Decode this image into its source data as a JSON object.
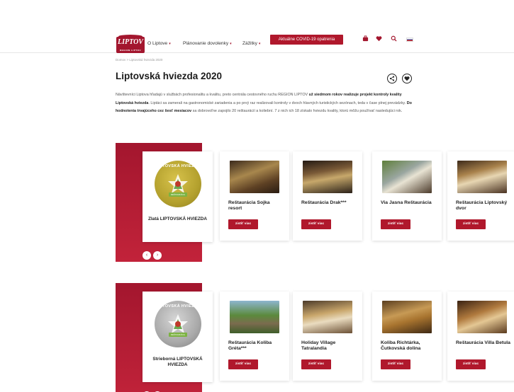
{
  "header": {
    "logo_text": "LIPTOV",
    "logo_sub": "REGION LIPTOV",
    "nav": [
      {
        "label": "O Liptove"
      },
      {
        "label": "Plánovanie dovolenky"
      },
      {
        "label": "Zážitky"
      }
    ],
    "covid_label": "Aktuálne COVID-19 opatrenia",
    "icons": [
      "suitcase-icon",
      "heart-icon",
      "search-icon",
      "flag-sk-icon"
    ]
  },
  "breadcrumb": "Domov > Liptovská hviezda 2020",
  "page_title": "Liptovská hviezda 2020",
  "intro": {
    "part1": "Návštevníci Liptova hľadajú v službách profesionalitu a kvalitu, preto centrála cestovného ruchu REGION LIPTOV ",
    "bold1": "už siedmom rokov realizuje projekt kontroly kvality Liptovská hviezda",
    "part2": ". Liptáci sa zamerali na gastronomické zariadenia a po prvý raz realizovali kontroly v dvoch hlavných turistických sezónach, teda v čase plnej prevádzky. ",
    "bold2": "Do hodnotenia trvajúceho cez šesť mesiacov",
    "part3": " sa dobrovoľne zapojilo 20 reštaurácií a koliební. 7 z nich ich 18 získalo hviezdu kvality, ktorú môžu používať nasledujúci rok."
  },
  "colors": {
    "accent": "#a3162e",
    "gold": "#c4b03a",
    "silver": "#a9a9a9"
  },
  "sections": [
    {
      "award": {
        "arc_text": "LIPTOVSKÁ HVIEZDA",
        "ribbon": "REŠTAURÁCIA",
        "name": "Zlatá LIPTOVSKÁ HVIEZDA"
      },
      "items": [
        {
          "name": "Reštaurácia Sojka resort",
          "button": "zistiť viac"
        },
        {
          "name": "Reštaurácia Drak***",
          "button": "zistiť viac"
        },
        {
          "name": "Via Jasna Reštaurácia",
          "button": "zistiť viac"
        },
        {
          "name": "Reštaurácia Liptovský dvor",
          "button": "zistiť viac"
        }
      ]
    },
    {
      "award": {
        "arc_text": "LIPTOVSKÁ HVIEZDA",
        "ribbon": "REŠTAURÁCIA",
        "name": "Strieborná LIPTOVSKÁ HVIEZDA"
      },
      "items": [
        {
          "name": "Reštaurácia Koliba Gréta***",
          "button": "zistiť viac"
        },
        {
          "name": "Holiday Village Tatralandia",
          "button": "zistiť viac"
        },
        {
          "name": "Koliba Richtárka, Čutkovská dolina",
          "button": "zistiť viac"
        },
        {
          "name": "Reštaurácia Villa Betula",
          "button": "zistiť viac"
        }
      ]
    }
  ]
}
